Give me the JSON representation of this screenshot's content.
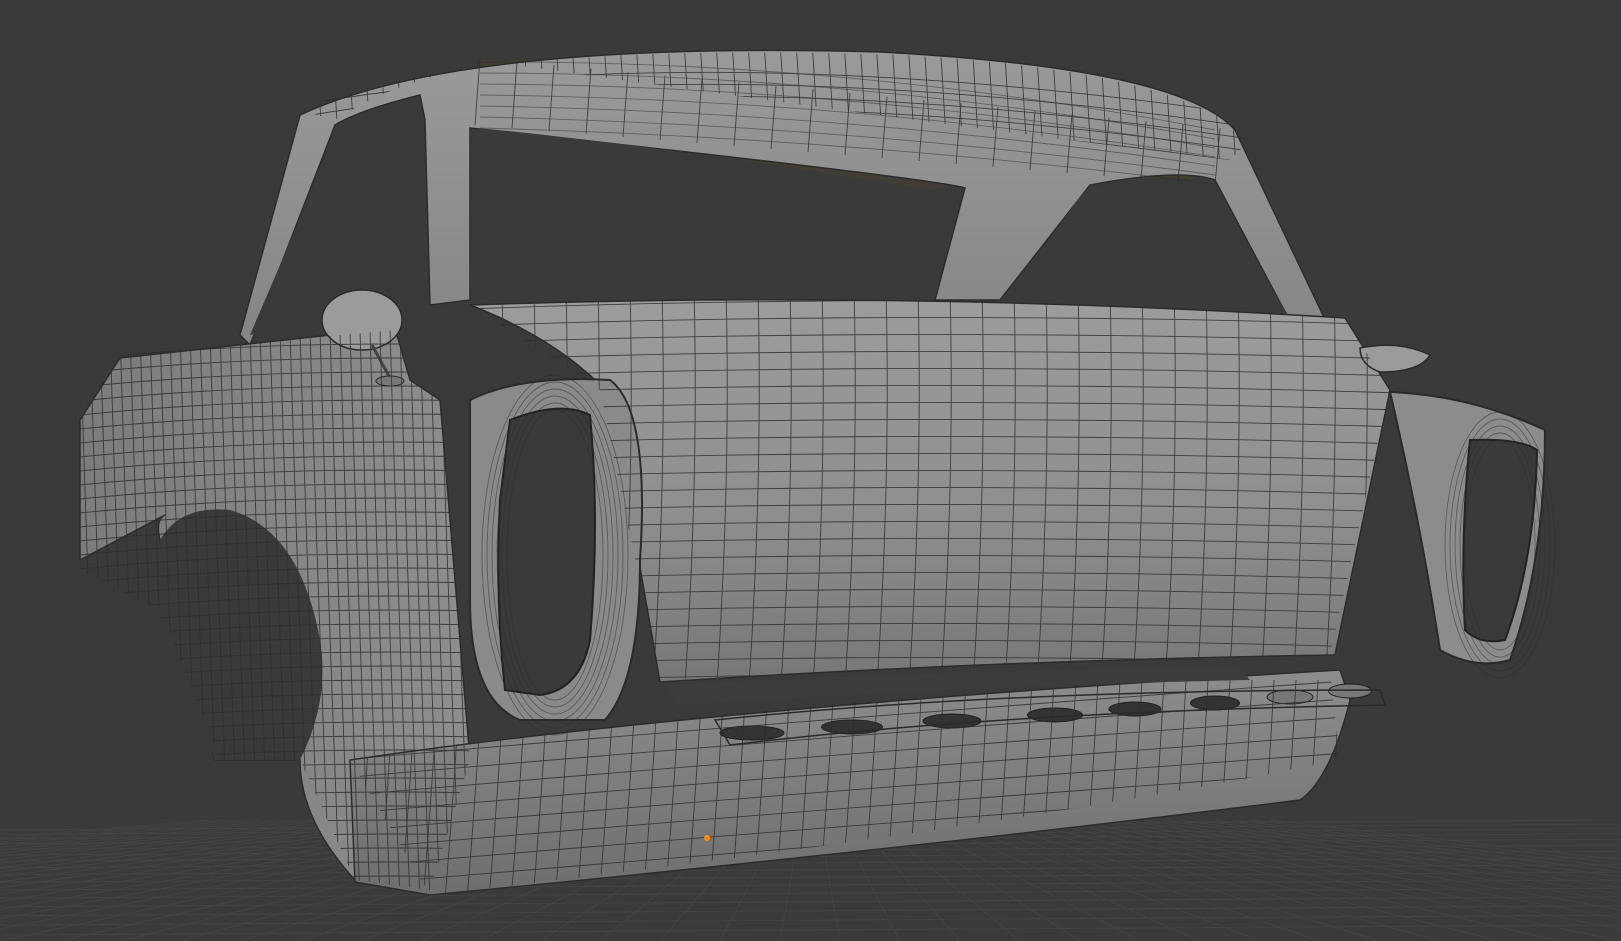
{
  "viewport": {
    "background": "#3a3a3a",
    "floor_grid": "#444444",
    "mesh_fill": "#8e8e8e",
    "mesh_fill_light": "#a3a3a3",
    "mesh_fill_dark": "#6c6c6c",
    "wire_color": "#2b2b2b",
    "interior_color": "#3b3a36",
    "origin_color": "#ff8a00"
  },
  "objects": [
    {
      "name": "car-body-mesh",
      "mode": "wireframe-over-solid"
    },
    {
      "name": "object-origin-point"
    }
  ]
}
